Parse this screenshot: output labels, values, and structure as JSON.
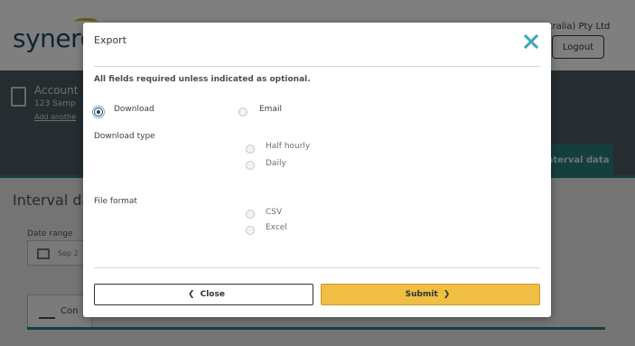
{
  "background": {
    "logo": "synerg",
    "company": "ustralia) Pty Ltd",
    "logout_label": "Logout",
    "account_label": "Account",
    "address": "123 Samp",
    "add_link": "Add anothe",
    "interval_button": "Interval data",
    "section_title": "Interval da",
    "date_range_label": "Date range",
    "date_value": "Sep 2",
    "tab_label": "Con"
  },
  "modal": {
    "title": "Export",
    "close_icon": "close-x-icon",
    "required_note": "All fields required unless indicated as optional.",
    "delivery": {
      "options": [
        {
          "label": "Download",
          "checked": true
        },
        {
          "label": "Email",
          "checked": false
        }
      ]
    },
    "download_type": {
      "label": "Download type",
      "options": [
        {
          "label": "Half hourly",
          "checked": false
        },
        {
          "label": "Daily",
          "checked": false
        }
      ]
    },
    "file_format": {
      "label": "File format",
      "options": [
        {
          "label": "CSV",
          "checked": false
        },
        {
          "label": "Excel",
          "checked": false
        }
      ]
    },
    "buttons": {
      "close_label": "Close",
      "submit_label": "Submit"
    }
  },
  "colors": {
    "accent_teal": "#3fa5b8",
    "submit_yellow": "#f0be43",
    "radio_checked": "#1b4767"
  }
}
